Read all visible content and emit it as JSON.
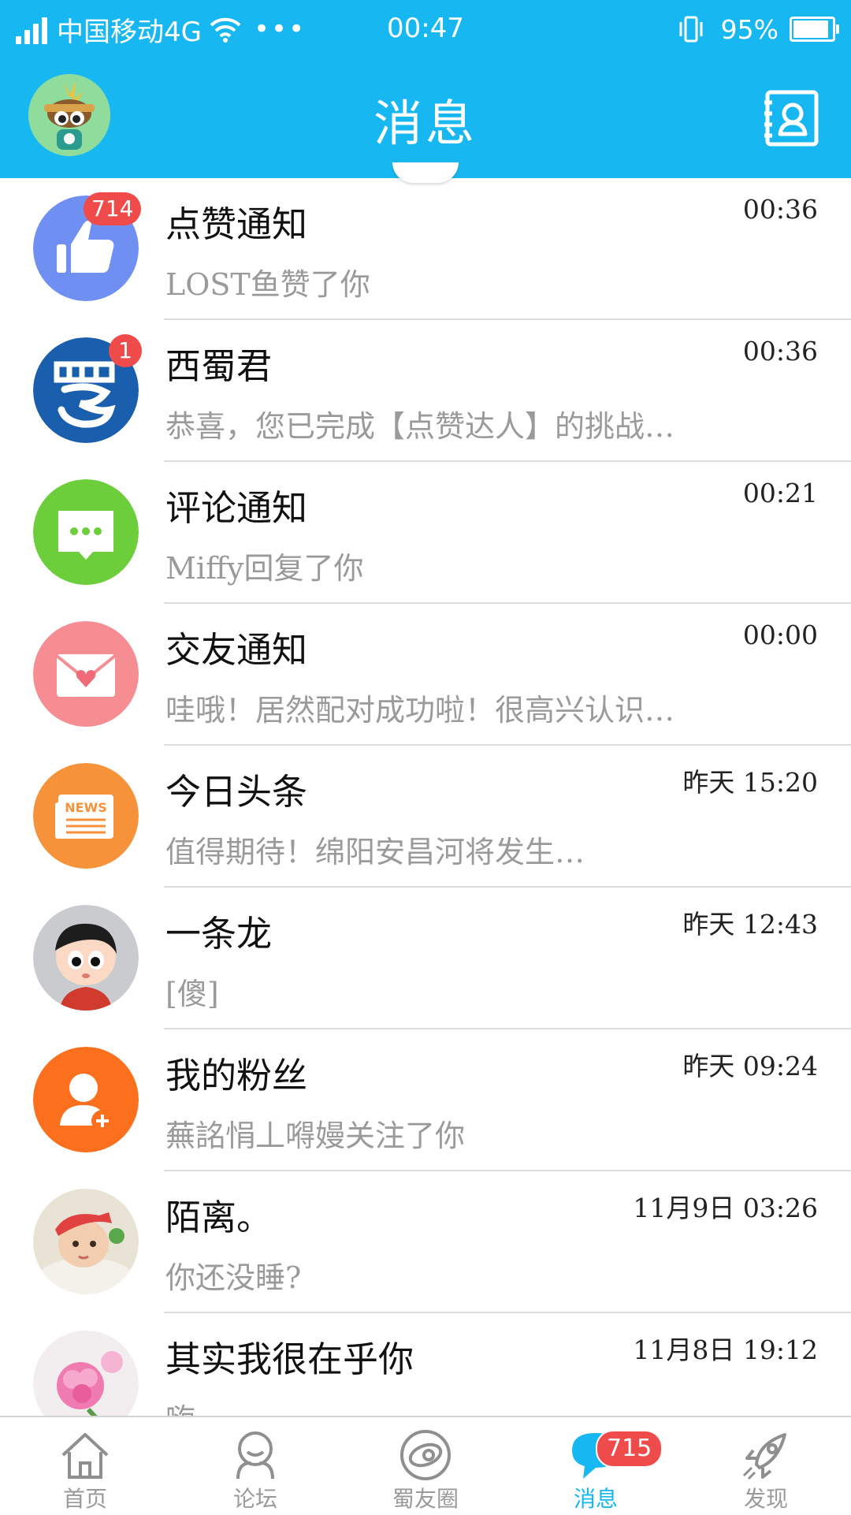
{
  "status_bar": {
    "carrier": "中国移动4G",
    "time": "00:47",
    "battery": "95%",
    "battery_level": 0.95
  },
  "header": {
    "title": "消息"
  },
  "colors": {
    "accent": "#17b8f2",
    "badge": "#ef4b4b"
  },
  "messages": [
    {
      "name": "点赞通知",
      "preview": "LOST鱼赞了你",
      "time": "00:36",
      "badge": "714",
      "icon": "thumbs-up-icon"
    },
    {
      "name": "西蜀君",
      "preview": "恭喜，您已完成【点赞达人】的挑战…",
      "time": "00:36",
      "badge": "1",
      "icon": "shu-logo-icon"
    },
    {
      "name": "评论通知",
      "preview": "Miffy回复了你",
      "time": "00:21",
      "badge": "",
      "icon": "comment-bubble-icon"
    },
    {
      "name": "交友通知",
      "preview": "哇哦！居然配对成功啦！很高兴认识…",
      "time": "00:00",
      "badge": "",
      "icon": "heart-envelope-icon"
    },
    {
      "name": "今日头条",
      "preview": "值得期待！绵阳安昌河将发生…",
      "time": "昨天 15:20",
      "badge": "",
      "icon": "news-icon",
      "icon_text": "NEWS"
    },
    {
      "name": "一条龙",
      "preview": "[傻]",
      "time": "昨天 12:43",
      "badge": "",
      "icon": "cartoon-boy-avatar"
    },
    {
      "name": "我的粉丝",
      "preview": "蕪詺悁丄嘚嫚关注了你",
      "time": "昨天 09:24",
      "badge": "",
      "icon": "add-user-icon"
    },
    {
      "name": "陌离。",
      "preview": "你还没睡?",
      "time": "11月9日 03:26",
      "badge": "",
      "icon": "baby-photo-avatar"
    },
    {
      "name": "其实我很在乎你",
      "preview": "嗨",
      "time": "11月8日 19:12",
      "badge": "",
      "icon": "flower-photo-avatar"
    }
  ],
  "tabbar": {
    "tabs": [
      {
        "label": "首页",
        "icon": "home-icon"
      },
      {
        "label": "论坛",
        "icon": "forum-icon"
      },
      {
        "label": "蜀友圈",
        "icon": "circle-icon"
      },
      {
        "label": "消息",
        "icon": "message-icon",
        "badge": "715"
      },
      {
        "label": "发现",
        "icon": "rocket-icon"
      }
    ],
    "active": "消息"
  }
}
